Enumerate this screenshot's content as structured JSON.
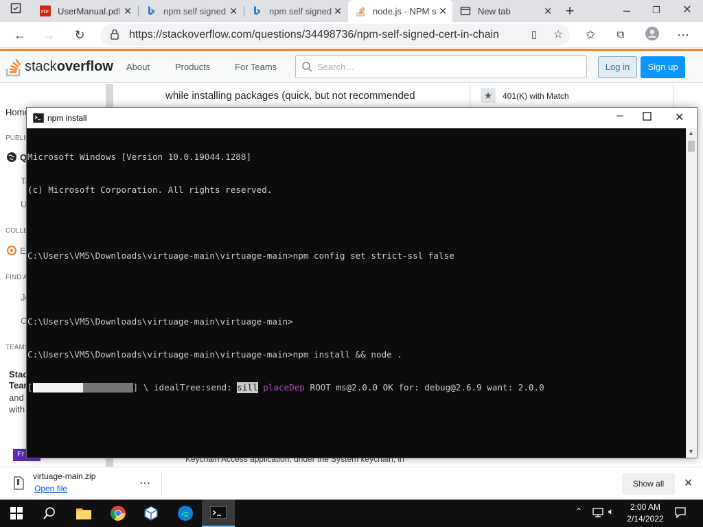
{
  "browser": {
    "tabs": [
      {
        "label": "UserManual.pdf",
        "icon": "pdf-icon"
      },
      {
        "label": "npm self signed",
        "icon": "bing-icon"
      },
      {
        "label": "npm self signed",
        "icon": "bing-icon"
      },
      {
        "label": "node.js - NPM s",
        "icon": "stackoverflow-icon"
      },
      {
        "label": "New tab",
        "icon": "new-tab-icon"
      }
    ],
    "new_tab": "+",
    "url": "https://stackoverflow.com/questions/34498736/npm-self-signed-cert-in-chain"
  },
  "so": {
    "logo_stack": "stack",
    "logo_overflow": "overflow",
    "nav": [
      "About",
      "Products",
      "For Teams"
    ],
    "search_placeholder": "Search…",
    "login": "Log in",
    "signup": "Sign up"
  },
  "background_page": {
    "sidebar": [
      "Home",
      "PUBLIC",
      "Q",
      "Ta",
      "U",
      "COLLE",
      "E",
      "FIND A",
      "Jo",
      "C",
      "TEAMS",
      "Stack",
      "Team",
      "and",
      "with",
      "Fr"
    ],
    "answer_line": "while installing packages (quick, but not recommended",
    "right_item": "401(K) with Match",
    "bottom_text": "Keychain Access  application, under the  System  keychain, in"
  },
  "cmd": {
    "title": "npm install",
    "lines": [
      "Microsoft Windows [Version 10.0.19044.1288]",
      "(c) Microsoft Corporation. All rights reserved.",
      "",
      "C:\\Users\\VM5\\Downloads\\virtuage-main\\virtuage-main>npm config set strict-ssl false",
      "",
      "C:\\Users\\VM5\\Downloads\\virtuage-main\\virtuage-main>",
      "C:\\Users\\VM5\\Downloads\\virtuage-main\\virtuage-main>npm install && node ."
    ],
    "progress": {
      "fraction": 0.5,
      "spinner": "\\",
      "stage": "idealTree:send:",
      "level": "sill",
      "action": "placeDep",
      "message": "ROOT ms@2.0.0 OK for: debug@2.6.9 want: 2.0.0"
    },
    "colors": {
      "level_bg": "#cccccc",
      "level_fg": "#0c0c0c",
      "action": "#b148c6"
    }
  },
  "downloads": {
    "file": "virtuage-main.zip",
    "open_link": "Open file",
    "show_all": "Show all"
  },
  "taskbar": {
    "time": "2:00 AM",
    "date": "2/14/2022"
  }
}
